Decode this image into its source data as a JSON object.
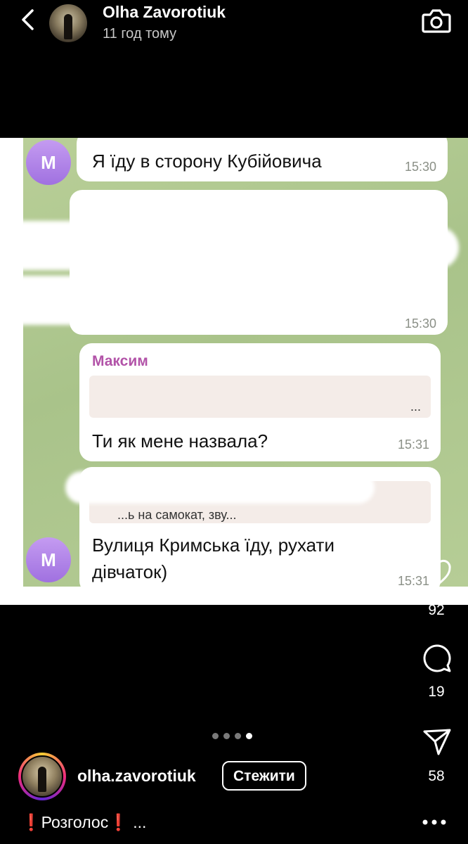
{
  "header": {
    "username": "Olha Zavorotiuk",
    "time": "11 год тому"
  },
  "chat": {
    "messages": [
      {
        "avatar_letter": "М",
        "text": "Я їду в сторону Кубійовича",
        "time": "15:30"
      },
      {
        "text": "",
        "time": "15:30"
      },
      {
        "sender": "Максим",
        "quoted_text": "...",
        "text": "Ти як мене назвала?",
        "time": "15:31"
      },
      {
        "avatar_letter": "М",
        "quoted_text": "...ь на самокат, зву...",
        "text_line1": "Вулиця Кримська їду, рухати",
        "text_line2": "дівчаток)",
        "time": "15:31"
      }
    ]
  },
  "actions": {
    "likes": "92",
    "comments": "19",
    "shares": "58"
  },
  "carousel": {
    "total": 4,
    "active": 4
  },
  "footer": {
    "username": "olha.zavorotiuk",
    "follow_label": "Стежити",
    "caption": "Розголос",
    "caption_more": "..."
  },
  "icons": [
    "back-icon",
    "camera-icon",
    "heart-icon",
    "comment-icon",
    "share-icon",
    "more-icon"
  ]
}
